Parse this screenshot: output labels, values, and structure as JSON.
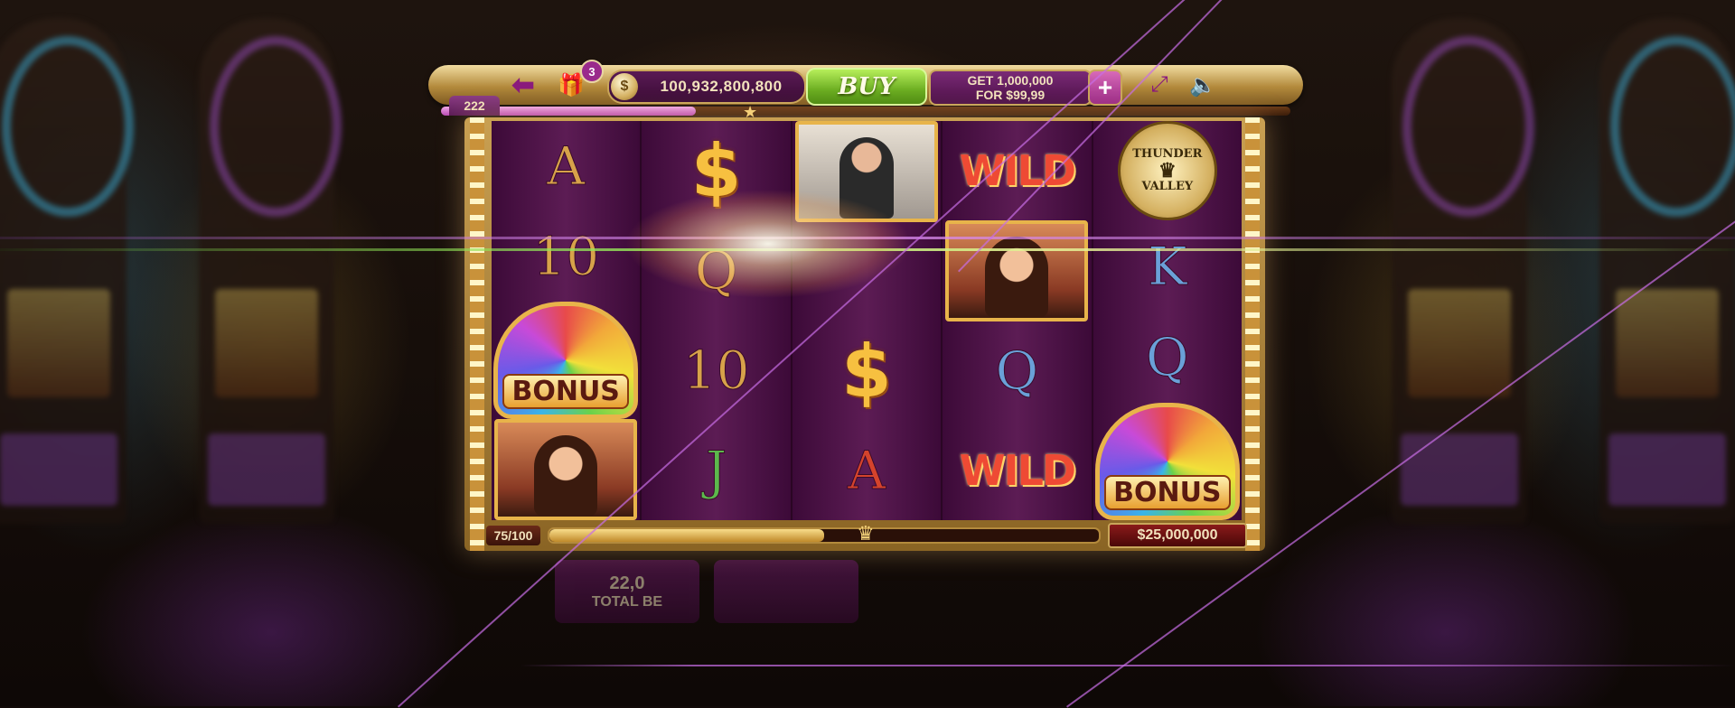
{
  "topbar": {
    "back_icon": "arrow-left-icon",
    "gift_icon": "gift-icon",
    "gift_badge": "3",
    "coin_icon": "coin-icon",
    "coins": "100,932,800,800",
    "buy_label": "BUY",
    "offer_line1": "GET 1,000,000",
    "offer_line2": "FOR $99,99",
    "plus_icon": "plus-icon",
    "fullscreen_icon": "fullscreen-icon",
    "sound_icon": "speaker-icon"
  },
  "level": {
    "number": "222",
    "progress": 0.3
  },
  "reels": [
    [
      {
        "type": "card",
        "text": "A",
        "color": "gold"
      },
      {
        "type": "card",
        "text": "10",
        "color": "gold"
      },
      {
        "type": "bonus",
        "text": "BONUS"
      },
      {
        "type": "woman"
      }
    ],
    [
      {
        "type": "dollar",
        "text": "$"
      },
      {
        "type": "card",
        "text": "Q",
        "color": "gold"
      },
      {
        "type": "card",
        "text": "10",
        "color": "gold"
      },
      {
        "type": "card",
        "text": "J",
        "color": "green"
      }
    ],
    [
      {
        "type": "man"
      },
      {
        "type": "flare"
      },
      {
        "type": "dollar",
        "text": "$"
      },
      {
        "type": "card",
        "text": "A",
        "color": "red"
      }
    ],
    [
      {
        "type": "wild",
        "text": "WILD"
      },
      {
        "type": "woman"
      },
      {
        "type": "card",
        "text": "Q",
        "color": "blue"
      },
      {
        "type": "wild",
        "text": "WILD"
      }
    ],
    [
      {
        "type": "logo",
        "line1": "THUNDER",
        "line2": "VALLEY"
      },
      {
        "type": "card",
        "text": "K",
        "color": "blue"
      },
      {
        "type": "card",
        "text": "Q",
        "color": "blue"
      },
      {
        "type": "bonus",
        "text": "BONUS"
      }
    ]
  ],
  "bottom": {
    "spin_count": "75/100",
    "progress": 0.5,
    "jackpot": "$25,000,000"
  },
  "bet": {
    "amount": "22,0",
    "label": "TOTAL BE"
  },
  "colors": {
    "accent_gold": "#c9a65a",
    "buy_green": "#6cae22",
    "panel_purple": "#5a1a56"
  }
}
